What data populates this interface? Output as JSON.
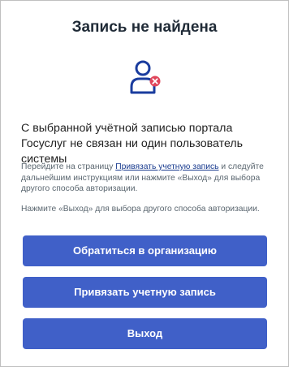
{
  "dialog": {
    "title": "Запись не найдена",
    "headline": "С выбранной учётной записью портала Госуслуг не связан ни один пользователь системы",
    "instructions": {
      "before_link": "Перейдите на страницу ",
      "link_text": "Привязать учетную запись",
      "after_link": " и следуйте дальнейшим инструкциям или нажмите «Выход» для выбора другого способа авторизации."
    },
    "note": "Нажмите «Выход» для выбора другого способа авторизации.",
    "buttons": {
      "contact_org": "Обратиться в организацию",
      "link_account": "Привязать учетную запись",
      "exit": "Выход"
    }
  },
  "icons": {
    "user": "user-not-found-icon"
  },
  "colors": {
    "accent": "#4060c8",
    "icon_blue": "#1a3c9e",
    "icon_badge": "#e0455a",
    "link": "#1a3c8f"
  }
}
